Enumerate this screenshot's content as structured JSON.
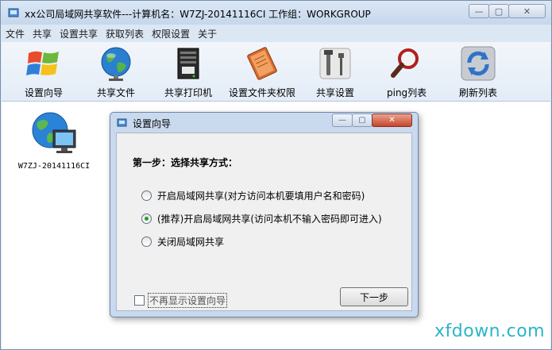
{
  "window": {
    "title": "xx公司局域网共享软件---计算机名：W7ZJ-20141116CI  工作组：WORKGROUP",
    "min_glyph": "—",
    "max_glyph": "▢",
    "close_glyph": "✕"
  },
  "menu": [
    {
      "label": "文件"
    },
    {
      "label": "共享"
    },
    {
      "label": "设置共享"
    },
    {
      "label": "获取列表"
    },
    {
      "label": "权限设置"
    },
    {
      "label": "关于"
    }
  ],
  "toolbar": [
    {
      "label": "设置向导",
      "icon": "windows-logo-icon"
    },
    {
      "label": "共享文件",
      "icon": "globe-icon"
    },
    {
      "label": "共享打印机",
      "icon": "printer-server-icon"
    },
    {
      "label": "设置文件夹权限",
      "icon": "notebook-icon"
    },
    {
      "label": "共享设置",
      "icon": "tools-icon"
    },
    {
      "label": "ping列表",
      "icon": "magnifier-icon"
    },
    {
      "label": "刷新列表",
      "icon": "refresh-icon"
    }
  ],
  "computers": [
    {
      "name": "W7ZJ-20141116CI",
      "icon": "network-computer-icon"
    }
  ],
  "dialog": {
    "title": "设置向导",
    "min_glyph": "—",
    "max_glyph": "▢",
    "close_glyph": "✕",
    "step": "第一步：选择共享方式：",
    "options": [
      {
        "label": "开启局域网共享(对方访问本机要填用户名和密码)",
        "selected": false
      },
      {
        "label": "(推荐)开启局域网共享(访问本机不输入密码即可进入)",
        "selected": true
      },
      {
        "label": "关闭局域网共享",
        "selected": false
      }
    ],
    "dont_show_label": "不再显示设置向导",
    "dont_show_checked": false,
    "next_label": "下一步"
  },
  "watermark": "xfdown.com",
  "colors": {
    "title_bar": "#c6d7ec",
    "dialog_frame": "#c9d9ee",
    "watermark": "#2bb5c8",
    "radio_selected": "#2a9d2a"
  }
}
